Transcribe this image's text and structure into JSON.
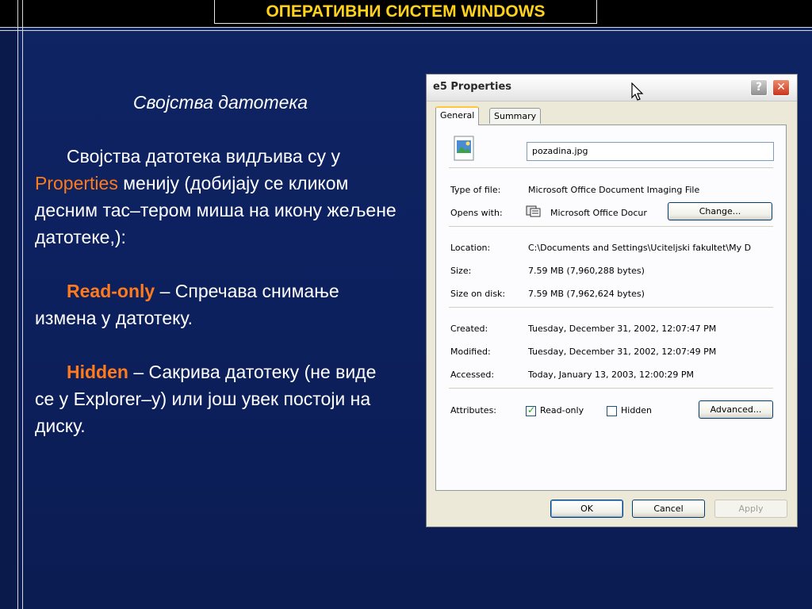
{
  "slide": {
    "title": "ОПЕРАТИВНИ СИСТЕМ WINDOWS",
    "subtitle": "Својства датотека",
    "p1_before": "Својства датотека видљива су у ",
    "p1_highlight": "Properties",
    "p1_after": " менију (добијају се кликом десним тас–тером миша на икону жељене датотеке,):",
    "p2_term": "Read-only",
    "p2_text": " – Спречава снимање измена у датотеку.",
    "p3_term": "Hidden",
    "p3_text": " – Сакрива датотеку (не виде се у Explorer–у) или још увек постоји на диску."
  },
  "dialog": {
    "title": "e5 Properties",
    "help_label": "?",
    "close_label": "✕",
    "tabs": [
      {
        "label": "General"
      },
      {
        "label": "Summary"
      }
    ],
    "file_name": "pozadina.jpg",
    "fields": {
      "type_label": "Type of file:",
      "type_value": "Microsoft Office Document Imaging File",
      "opens_label": "Opens with:",
      "opens_value": "Microsoft Office Docur",
      "change_button": "Change...",
      "location_label": "Location:",
      "location_value": "C:\\Documents and Settings\\Uciteljski fakultet\\My D",
      "size_label": "Size:",
      "size_value": "7.59 MB (7,960,288 bytes)",
      "size_disk_label": "Size on disk:",
      "size_disk_value": "7.59 MB (7,962,624 bytes)",
      "created_label": "Created:",
      "created_value": "Tuesday, December 31, 2002, 12:07:47 PM",
      "modified_label": "Modified:",
      "modified_value": "Tuesday, December 31, 2002, 12:07:49 PM",
      "accessed_label": "Accessed:",
      "accessed_value": "Today, January 13, 2003, 12:00:29 PM",
      "attributes_label": "Attributes:",
      "readonly_label": "Read-only",
      "readonly_checked": true,
      "hidden_label": "Hidden",
      "hidden_checked": false,
      "advanced_button": "Advanced..."
    },
    "buttons": {
      "ok": "OK",
      "cancel": "Cancel",
      "apply": "Apply"
    }
  },
  "colors": {
    "background": "#0d2160",
    "title": "#ffd21a",
    "accent": "#ff7a1a"
  }
}
